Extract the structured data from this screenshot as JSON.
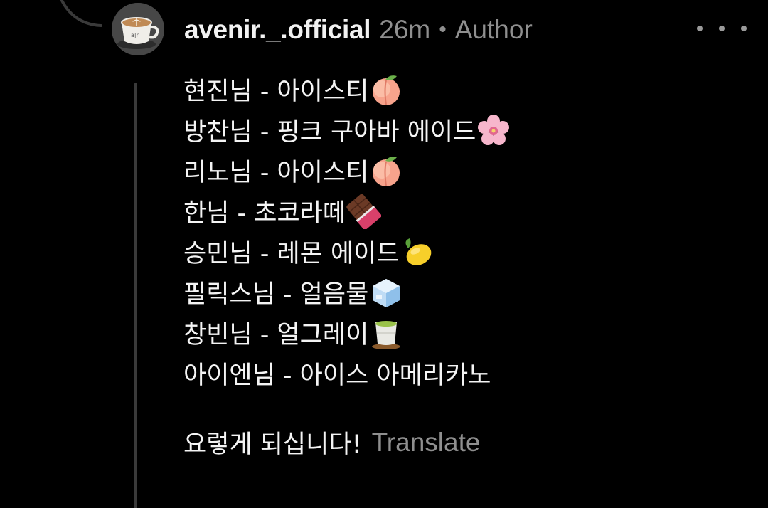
{
  "comment": {
    "username": "avenir._.official",
    "time": "26m",
    "separator": "•",
    "badge": "Author",
    "lines": [
      {
        "text": "현진님 - 아이스티",
        "emoji": "peach"
      },
      {
        "text": "방찬님 - 핑크 구아바 에이드",
        "emoji": "cherry-blossom"
      },
      {
        "text": "리노님 - 아이스티",
        "emoji": "peach"
      },
      {
        "text": "한님 - 초코라떼",
        "emoji": "chocolate-bar"
      },
      {
        "text": "승민님 - 레몬 에이드",
        "emoji": "lemon"
      },
      {
        "text": "필릭스님 - 얼음물",
        "emoji": "ice"
      },
      {
        "text": "창빈님 - 얼그레이",
        "emoji": "teacup"
      },
      {
        "text": "아이엔님 - 아이스 아메리카노",
        "emoji": ""
      }
    ],
    "closing": "요렇게 되십니다!",
    "translate_label": "Translate"
  },
  "colors": {
    "background": "#000000",
    "text": "#f4f4f4",
    "muted": "#8f8f8f",
    "thread_line": "#3a3a3a"
  },
  "icons": {
    "avatar": "latte-cup-avatar",
    "more": "more-horizontal-icon"
  }
}
